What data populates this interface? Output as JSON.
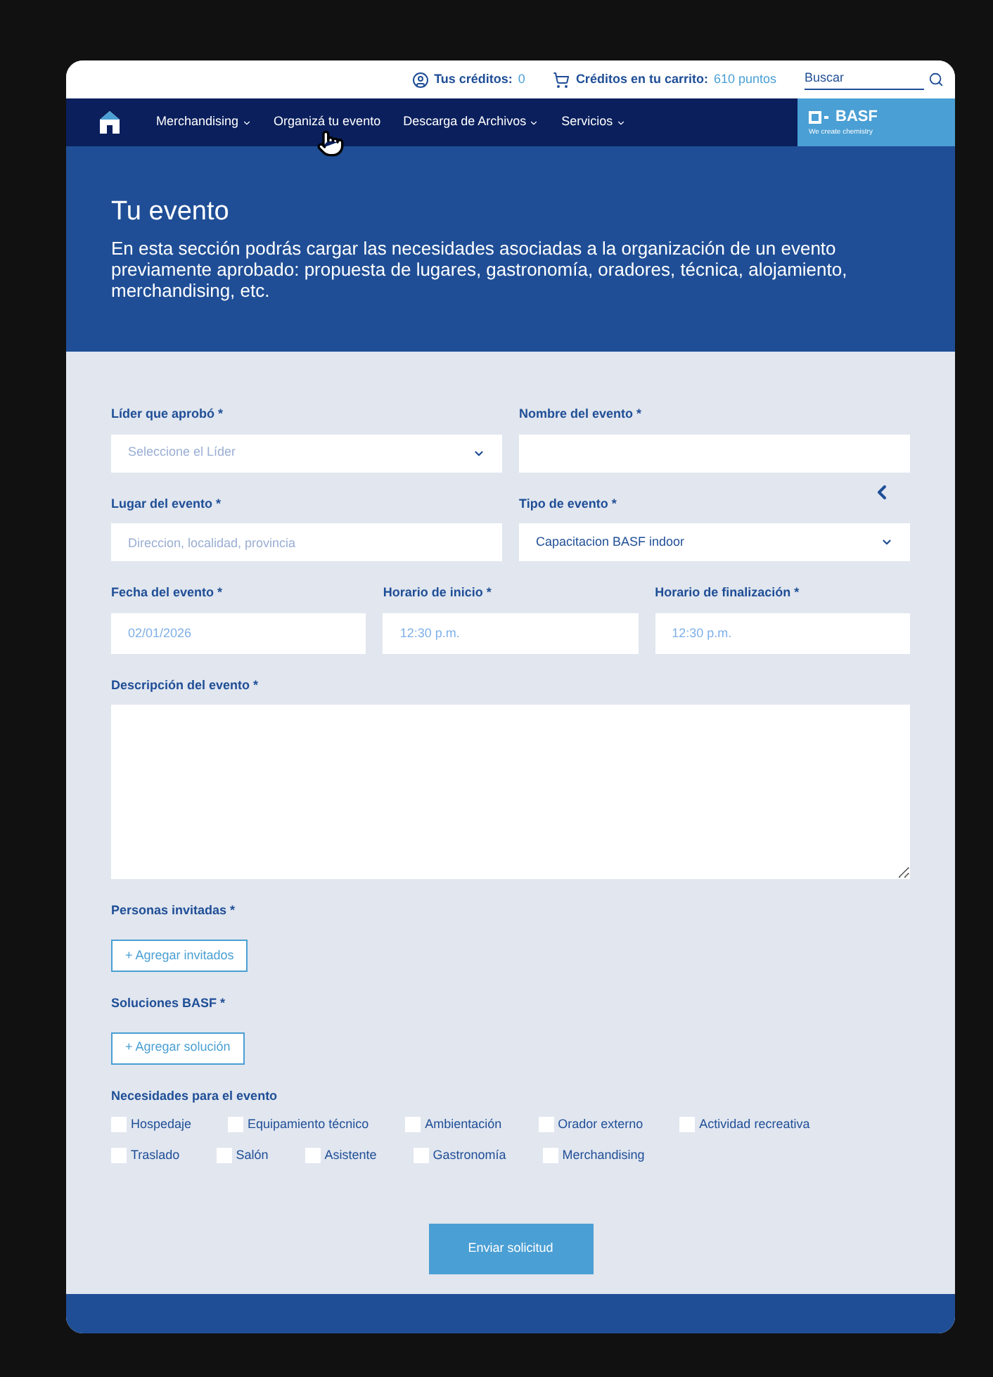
{
  "top_bar": {
    "credits_label": "Tus créditos:",
    "credits_value": "0",
    "cart_label": "Créditos en tu carrito:",
    "cart_value": "610 puntos",
    "search": {
      "placeholder": "Buscar"
    }
  },
  "nav": {
    "items": [
      {
        "label": "Merchandising",
        "dropdown": true
      },
      {
        "label": "Organizá tu evento",
        "dropdown": false
      },
      {
        "label": "Descarga de Archivos",
        "dropdown": true
      },
      {
        "label": "Servicios",
        "dropdown": true
      }
    ],
    "logo": {
      "name": "BASF",
      "tagline": "We create chemistry"
    }
  },
  "hero": {
    "title": "Tu evento",
    "description": "En esta sección podrás cargar las necesidades asociadas a la organización de un evento previamente aprobado: propuesta de lugares, gastronomía, oradores, técnica, alojamiento, merchandising, etc."
  },
  "form": {
    "rows": [
      [
        {
          "label": "Líder que aprobó *",
          "kind": "select",
          "placeholder": "Seleccione el Líder"
        },
        {
          "label": "Nombre del evento *",
          "kind": "text"
        }
      ],
      [
        {
          "label": "Lugar del evento *",
          "kind": "text",
          "placeholder": "Direccion, localidad, provincia"
        },
        {
          "label": "Tipo de evento *",
          "kind": "select",
          "value": "Capacitacion BASF indoor"
        }
      ],
      [
        {
          "label": "Fecha del evento *",
          "kind": "date",
          "value": "02/01/2026"
        },
        {
          "label": "Horario de inicio *",
          "kind": "time",
          "value": "12:30 p.m."
        },
        {
          "label": "Horario de finalización *",
          "kind": "time",
          "value": "12:30 p.m."
        }
      ],
      [
        {
          "label": "Descripción del evento *",
          "kind": "textarea"
        }
      ]
    ],
    "guests": {
      "label": "Personas invitadas *",
      "button": "+ Agregar invitados"
    },
    "solutions": {
      "label": "Soluciones BASF *",
      "button": "+ Agregar solución"
    },
    "needs": {
      "label": "Necesidades para el evento",
      "options": [
        {
          "label": "Hospedaje",
          "checked": false
        },
        {
          "label": "Equipamiento técnico",
          "checked": false
        },
        {
          "label": "Ambientación",
          "checked": false
        },
        {
          "label": "Orador externo",
          "checked": false
        },
        {
          "label": "Actividad recreativa",
          "checked": false
        },
        {
          "label": "Traslado",
          "checked": false
        },
        {
          "label": "Salón",
          "checked": false
        },
        {
          "label": "Asistente",
          "checked": false
        },
        {
          "label": "Gastronomía",
          "checked": false
        },
        {
          "label": "Merchandising",
          "checked": false
        }
      ]
    },
    "submit": "Enviar solicitud"
  }
}
